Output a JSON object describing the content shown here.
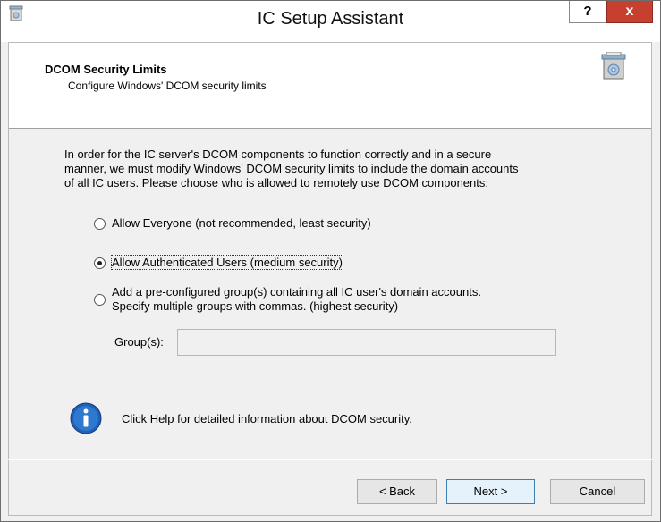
{
  "window": {
    "title": "IC Setup Assistant",
    "help_label": "?",
    "close_label": "x"
  },
  "header": {
    "title": "DCOM Security Limits",
    "subtitle": "Configure Windows' DCOM security limits"
  },
  "intro": {
    "line1": "In order for the IC server's DCOM components to function correctly and in a secure",
    "line2": "manner, we must modify Windows' DCOM security limits to include the domain accounts",
    "line3": "of all IC users.  Please choose who is allowed to remotely use DCOM components:"
  },
  "options": [
    {
      "label": "Allow Everyone (not recommended, least security)",
      "selected": false
    },
    {
      "label": "Allow Authenticated Users (medium security)",
      "selected": true
    },
    {
      "label_line1": "Add a pre-configured group(s) containing all IC user's domain accounts.",
      "label_line2": "Specify multiple groups with commas. (highest security)",
      "selected": false
    }
  ],
  "groups": {
    "label": "Group(s):",
    "value": ""
  },
  "info": {
    "text": "Click Help for detailed information about DCOM security."
  },
  "buttons": {
    "back": "< Back",
    "next": "Next >",
    "cancel": "Cancel"
  },
  "colors": {
    "close": "#c7402f",
    "info_icon": "#1f5fb4",
    "default_button_border": "#3c7fb1"
  }
}
